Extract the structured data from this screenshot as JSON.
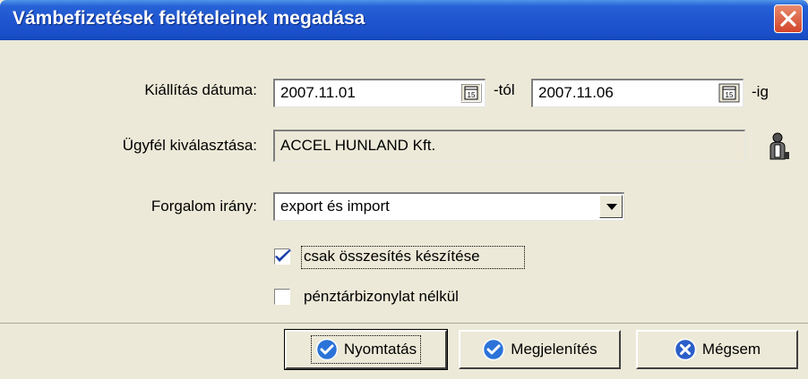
{
  "window": {
    "title": "Vámbefizetések feltételeinek megadása",
    "close_icon": "close-icon"
  },
  "form": {
    "date_label": "Kiállítás dátuma:",
    "date_from": "2007.11.01",
    "date_from_suffix": "-tól",
    "date_to": "2007.11.06",
    "date_to_suffix": "-ig",
    "calendar_icon_text": "15",
    "client_label": "Ügyfél kiválasztása:",
    "client_value": "ACCEL HUNLAND Kft.",
    "direction_label": "Forgalom irány:",
    "direction_selected": "export és import",
    "summary_checkbox_label": "csak összesítés készítése",
    "summary_checked": true,
    "cashier_checkbox_label": "pénztárbizonylat nélkül",
    "cashier_checked": false
  },
  "buttons": {
    "print": "Nyomtatás",
    "display": "Megjelenítés",
    "cancel": "Mégsem"
  },
  "colors": {
    "titlebar": "#1f55cf",
    "window_bg": "#ece9d8",
    "ok_icon": "#2b73d8",
    "cancel_icon": "#2b5fc9"
  }
}
